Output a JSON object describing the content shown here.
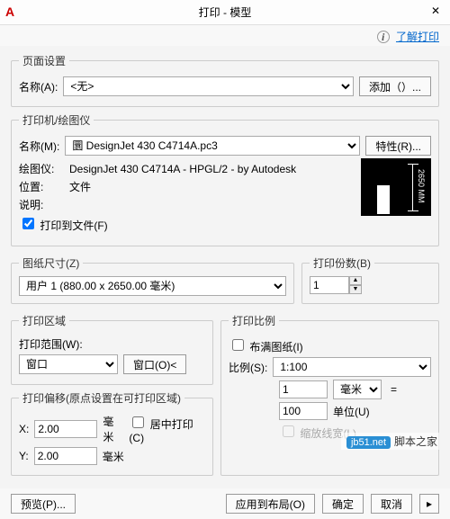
{
  "title": "打印 - 模型",
  "info_link": "了解打印",
  "learn_icon": "i",
  "page_setup": {
    "legend": "页面设置",
    "name_label": "名称(A):",
    "name_value": "<无>",
    "add_btn": "添加（）..."
  },
  "printer": {
    "legend": "打印机/绘图仪",
    "name_label": "名称(M):",
    "name_value": "圜 DesignJet 430 C4714A.pc3",
    "props_btn": "特性(R)...",
    "plotter_label": "绘图仪:",
    "plotter_value": "DesignJet 430 C4714A - HPGL/2 - by Autodesk",
    "where_label": "位置:",
    "where_value": "文件",
    "desc_label": "说明:",
    "to_file_label": "打印到文件(F)",
    "preview_dim": "2650 MM"
  },
  "paper": {
    "legend": "图纸尺寸(Z)",
    "value": "用户 1 (880.00 x 2650.00 毫米)"
  },
  "copies": {
    "legend": "打印份数(B)",
    "value": "1"
  },
  "area": {
    "legend": "打印区域",
    "what_label": "打印范围(W):",
    "what_value": "窗口",
    "window_btn": "窗口(O)<"
  },
  "offset": {
    "legend": "打印偏移(原点设置在可打印区域)",
    "x_label": "X:",
    "x_value": "2.00",
    "y_label": "Y:",
    "y_value": "2.00",
    "unit": "毫米",
    "center_label": "居中打印(C)"
  },
  "scale": {
    "legend": "打印比例",
    "fit_label": "布满图纸(I)",
    "scale_label": "比例(S):",
    "scale_value": "1:100",
    "top_value": "1",
    "top_unit": "毫米",
    "bottom_value": "100",
    "bottom_unit_label": "单位(U)",
    "lw_label": "缩放线宽(L)"
  },
  "footer": {
    "preview": "预览(P)...",
    "apply": "应用到布局(O)",
    "ok": "确定",
    "cancel": "取消"
  },
  "watermark": {
    "site": "脚本之家",
    "badge": "jb51.net"
  }
}
